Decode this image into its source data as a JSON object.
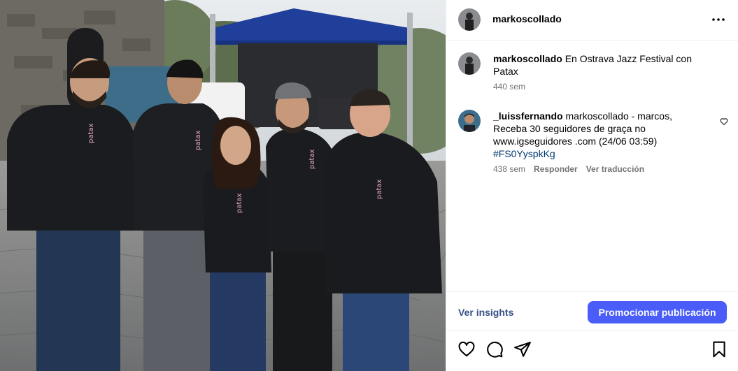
{
  "post": {
    "username": "markoscollado",
    "brand_text": "patax"
  },
  "caption": {
    "username": "markoscollado",
    "text": " En Ostrava Jazz Festival con Patax",
    "time": "440 sem"
  },
  "comment": {
    "username": "_luissfernando",
    "text": " markoscollado - marcos, Receba 30 seguidores de graça no www.igseguidores .com (24/06 03:59)",
    "hashtag": "#FS0YyspkKg",
    "time": "438 sem",
    "reply_label": "Responder",
    "translate_label": "Ver traducción"
  },
  "insights": {
    "view_label": "Ver insights",
    "promote_label": "Promocionar publicación"
  },
  "icons": {
    "more": "more-horizontal-icon",
    "like": "heart-icon",
    "comment": "comment-icon",
    "share": "send-icon",
    "save": "bookmark-icon"
  },
  "colors": {
    "promote_button": "#4a5df9",
    "link": "#385185",
    "hashtag": "#00376b",
    "meta_text": "#737373"
  }
}
